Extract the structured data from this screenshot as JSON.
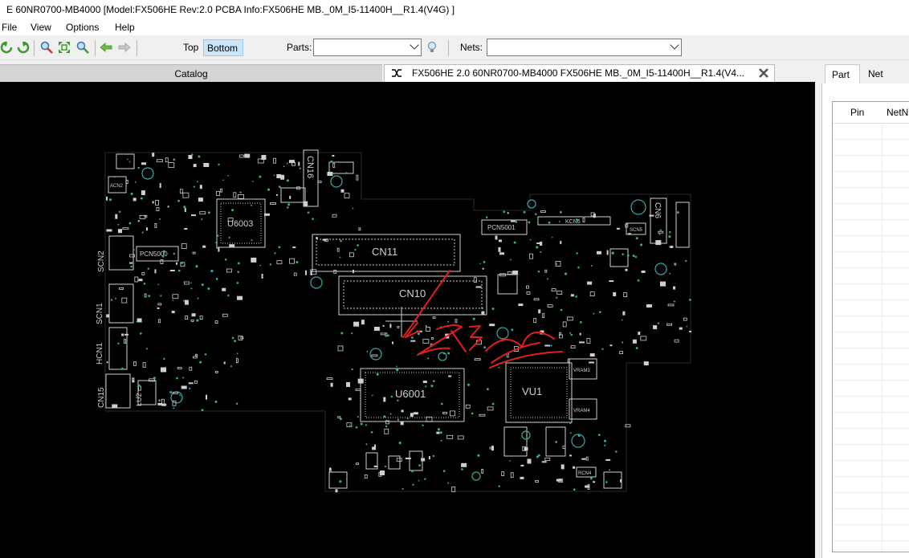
{
  "window": {
    "title": "E 60NR0700-MB4000 [Model:FX506HE  Rev:2.0 PCBA Info:FX506HE MB._0M_I5-11400H__R1.4(V4G) ]"
  },
  "menu": {
    "items": [
      "File",
      "View",
      "Options",
      "Help"
    ]
  },
  "toolbar": {
    "top_label": "Top",
    "bottom_label": "Bottom",
    "parts_label": "Parts:",
    "parts_value": "",
    "nets_label": "Nets:",
    "nets_value": ""
  },
  "tabs": {
    "catalog": "Catalog",
    "document": "FX506HE 2.0 60NR0700-MB4000 FX506HE MB._0M_I5-11400H__R1.4(V4..."
  },
  "side": {
    "tab_part": "Part",
    "tab_net": "Net",
    "col_pin": "Pin",
    "col_netname": "NetNa"
  },
  "board": {
    "labels": [
      "CN11",
      "CN10",
      "U6001",
      "VU1",
      "KCN6",
      "PCN5001",
      "CN16",
      "U6003",
      "SCN2",
      "SCN1",
      "HCN1",
      "CN15",
      "LU2",
      "ACN2",
      "PCN5000",
      "VRAM3",
      "VRAM4",
      "CN6",
      "SCN5",
      "RCN4"
    ],
    "annotation": "ZK3"
  },
  "colors": {
    "board_background": "#000000",
    "silkscreen": "#cfcfcf",
    "via": "#3aa8a8",
    "annotation": "#e31e1e",
    "active_toggle": "#cce4f7"
  }
}
